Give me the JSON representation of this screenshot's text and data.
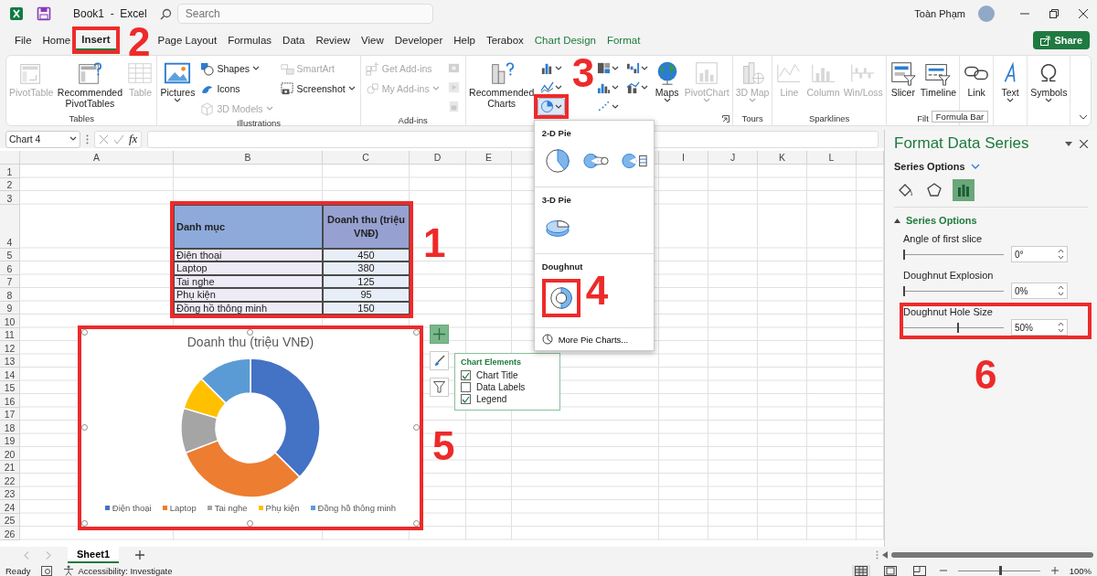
{
  "title_bar": {
    "document_title": "Book1  -  Excel",
    "search": {
      "placeholder": "Search"
    },
    "user_name": "Toàn Phạm"
  },
  "menu_tabs": [
    {
      "label": "File",
      "selected": false,
      "contextual": false
    },
    {
      "label": "Home",
      "selected": false,
      "contextual": false
    },
    {
      "label": "Insert",
      "selected": true,
      "contextual": false
    },
    {
      "label": "Page Layout",
      "selected": false,
      "contextual": false
    },
    {
      "label": "Formulas",
      "selected": false,
      "contextual": false
    },
    {
      "label": "Data",
      "selected": false,
      "contextual": false
    },
    {
      "label": "Review",
      "selected": false,
      "contextual": false
    },
    {
      "label": "View",
      "selected": false,
      "contextual": false
    },
    {
      "label": "Developer",
      "selected": false,
      "contextual": false
    },
    {
      "label": "Help",
      "selected": false,
      "contextual": false
    },
    {
      "label": "Terabox",
      "selected": false,
      "contextual": false
    },
    {
      "label": "Chart Design",
      "selected": false,
      "contextual": true
    },
    {
      "label": "Format",
      "selected": false,
      "contextual": true
    }
  ],
  "share_button": {
    "label": "Share"
  },
  "ribbon": {
    "groups": [
      {
        "label": "Tables",
        "items": [
          {
            "label": "PivotTable",
            "kind": "large",
            "disabled": true
          },
          {
            "label": "Recommended PivotTables",
            "kind": "large",
            "disabled": false
          },
          {
            "label": "Table",
            "kind": "large",
            "disabled": true
          }
        ]
      },
      {
        "label": "Illustrations",
        "items": [
          {
            "label": "Pictures",
            "kind": "large",
            "disabled": false,
            "caret": true
          },
          {
            "label": "Shapes",
            "kind": "small",
            "disabled": false,
            "caret": true
          },
          {
            "label": "Icons",
            "kind": "small",
            "disabled": false,
            "caret": false
          },
          {
            "label": "3D Models",
            "kind": "small",
            "disabled": true,
            "caret": true
          },
          {
            "label": "SmartArt",
            "kind": "small",
            "disabled": true,
            "caret": false
          },
          {
            "label": "Screenshot",
            "kind": "small",
            "disabled": false,
            "caret": true
          }
        ]
      },
      {
        "label": "Add-ins",
        "items": [
          {
            "label": "Get Add-ins",
            "kind": "small",
            "disabled": true,
            "caret": false
          },
          {
            "label": "My Add-ins",
            "kind": "small",
            "disabled": true,
            "caret": true
          },
          {
            "kind": "icon",
            "disabled": true
          },
          {
            "kind": "icon",
            "disabled": true
          },
          {
            "kind": "icon",
            "disabled": true
          }
        ]
      },
      {
        "launcher": true,
        "items": [
          {
            "label": "Recommended Charts",
            "kind": "large",
            "disabled": false
          },
          {
            "kind": "icon",
            "caret": true,
            "selected": false
          },
          {
            "kind": "icon",
            "caret": true,
            "selected": false
          },
          {
            "kind": "icon",
            "caret": true,
            "selected": true
          },
          {
            "kind": "icon",
            "caret": true,
            "selected": false
          },
          {
            "kind": "icon",
            "caret": true,
            "selected": false
          },
          {
            "kind": "icon",
            "caret": true,
            "selected": false
          },
          {
            "kind": "icon",
            "caret": true,
            "selected": false
          },
          {
            "kind": "icon",
            "caret": true,
            "selected": false
          },
          {
            "label": "Maps",
            "kind": "large",
            "disabled": false,
            "caret": true
          },
          {
            "label": "PivotChart",
            "kind": "large",
            "disabled": true,
            "caret": true
          }
        ]
      },
      {
        "label": "Tours",
        "items": [
          {
            "label": "3D Map",
            "kind": "large",
            "disabled": true,
            "caret": true
          }
        ]
      },
      {
        "label": "Sparklines",
        "items": [
          {
            "label": "Line",
            "kind": "large",
            "disabled": true
          },
          {
            "label": "Column",
            "kind": "large",
            "disabled": true
          },
          {
            "label": "Win/Loss",
            "kind": "large",
            "disabled": true
          }
        ]
      },
      {
        "label": "Filt",
        "items": [
          {
            "label": "Slicer",
            "kind": "large",
            "disabled": false
          },
          {
            "label": "Timeline",
            "kind": "large",
            "disabled": false
          }
        ]
      },
      {
        "items": [
          {
            "label": "Link",
            "kind": "large",
            "disabled": false
          }
        ]
      },
      {
        "items": [
          {
            "label": "Text",
            "kind": "large",
            "disabled": false,
            "caret": true
          }
        ]
      },
      {
        "items": [
          {
            "label": "Symbols",
            "kind": "large",
            "disabled": false,
            "caret": true
          }
        ]
      }
    ]
  },
  "tooltip": {
    "text": "Formula Bar"
  },
  "formula_bar": {
    "name_box": "Chart 4",
    "function_label": "fx"
  },
  "sheet": {
    "column_headers": [
      "A",
      "B",
      "C",
      "D",
      "E",
      "I",
      "J",
      "K",
      "L"
    ],
    "row_headers": [
      "1",
      "2",
      "3",
      "4",
      "5",
      "6",
      "7",
      "8",
      "9",
      "10",
      "11",
      "12",
      "13",
      "14",
      "15",
      "16",
      "17",
      "18",
      "19",
      "20",
      "21",
      "22",
      "23",
      "24",
      "25",
      "26"
    ],
    "table": {
      "columns": [
        "Danh mục",
        "Doanh thu (triệu VNĐ)"
      ],
      "rows": [
        [
          "Điện thoại",
          "450"
        ],
        [
          "Laptop",
          "380"
        ],
        [
          "Tai nghe",
          "125"
        ],
        [
          "Phụ kiện",
          "95"
        ],
        [
          "Đồng hồ thông minh",
          "150"
        ]
      ]
    }
  },
  "chart": {
    "chart_data": {
      "type": "donut",
      "title": "Doanh thu (triệu VNĐ)",
      "categories": [
        "Điện thoại",
        "Laptop",
        "Tai nghe",
        "Phụ kiện",
        "Đồng hồ thông minh"
      ],
      "series": [
        {
          "values": [
            37.5,
            31.67,
            10.42,
            7.91,
            12.5
          ]
        }
      ],
      "legend": "bottom",
      "colors": [
        "#4472c4",
        "#ed7d31",
        "#a5a5a5",
        "#ffc000",
        "#5b9bd5"
      ]
    }
  },
  "chart_elements": {
    "title": "Chart Elements",
    "items": [
      {
        "label": "Chart Title",
        "checked": true
      },
      {
        "label": "Data Labels",
        "checked": false
      },
      {
        "label": "Legend",
        "checked": true
      }
    ]
  },
  "pie_menu": {
    "sections": [
      {
        "heading": "2-D Pie",
        "options": [
          {
            "kind": "pie"
          },
          {
            "kind": "pie-of-pie"
          },
          {
            "kind": "bar-of-pie"
          }
        ]
      },
      {
        "heading": "3-D Pie",
        "options": [
          {
            "kind": "pie-3d"
          }
        ]
      },
      {
        "heading": "Doughnut",
        "options": [
          {
            "kind": "doughnut"
          }
        ]
      }
    ],
    "more_link": "More Pie Charts..."
  },
  "format_pane": {
    "title": "Format Data Series",
    "options_menu": "Series Options",
    "tabs": [
      {
        "kind": "fill",
        "selected": false
      },
      {
        "kind": "effects",
        "selected": false
      },
      {
        "kind": "series",
        "selected": true
      }
    ],
    "section": {
      "title": "Series Options",
      "expanded": true,
      "settings": [
        {
          "label": "Angle of first slice",
          "level": 0,
          "value": "0°"
        },
        {
          "label": "Doughnut Explosion",
          "level": 0,
          "value": "0%"
        },
        {
          "label": "Doughnut Hole Size",
          "level": 0.54,
          "value": "50%"
        }
      ]
    }
  },
  "sheet_tabs": [
    {
      "label": "Sheet1",
      "selected": true
    }
  ],
  "status_bar": {
    "mode": "Ready",
    "accessibility": "Accessibility: Investigate",
    "views": [
      {
        "kind": "normal",
        "selected": true
      },
      {
        "kind": "page-layout",
        "selected": false
      },
      {
        "kind": "page-break",
        "selected": false
      }
    ],
    "zoom": {
      "level": 0.5,
      "value": "100%"
    }
  },
  "annotations": [
    {
      "number": "1",
      "framed": true
    },
    {
      "number": "2",
      "framed": true
    },
    {
      "number": "3",
      "framed": true
    },
    {
      "number": "4",
      "framed": true
    },
    {
      "number": "5",
      "framed": true
    },
    {
      "number": "6",
      "framed": true
    }
  ]
}
